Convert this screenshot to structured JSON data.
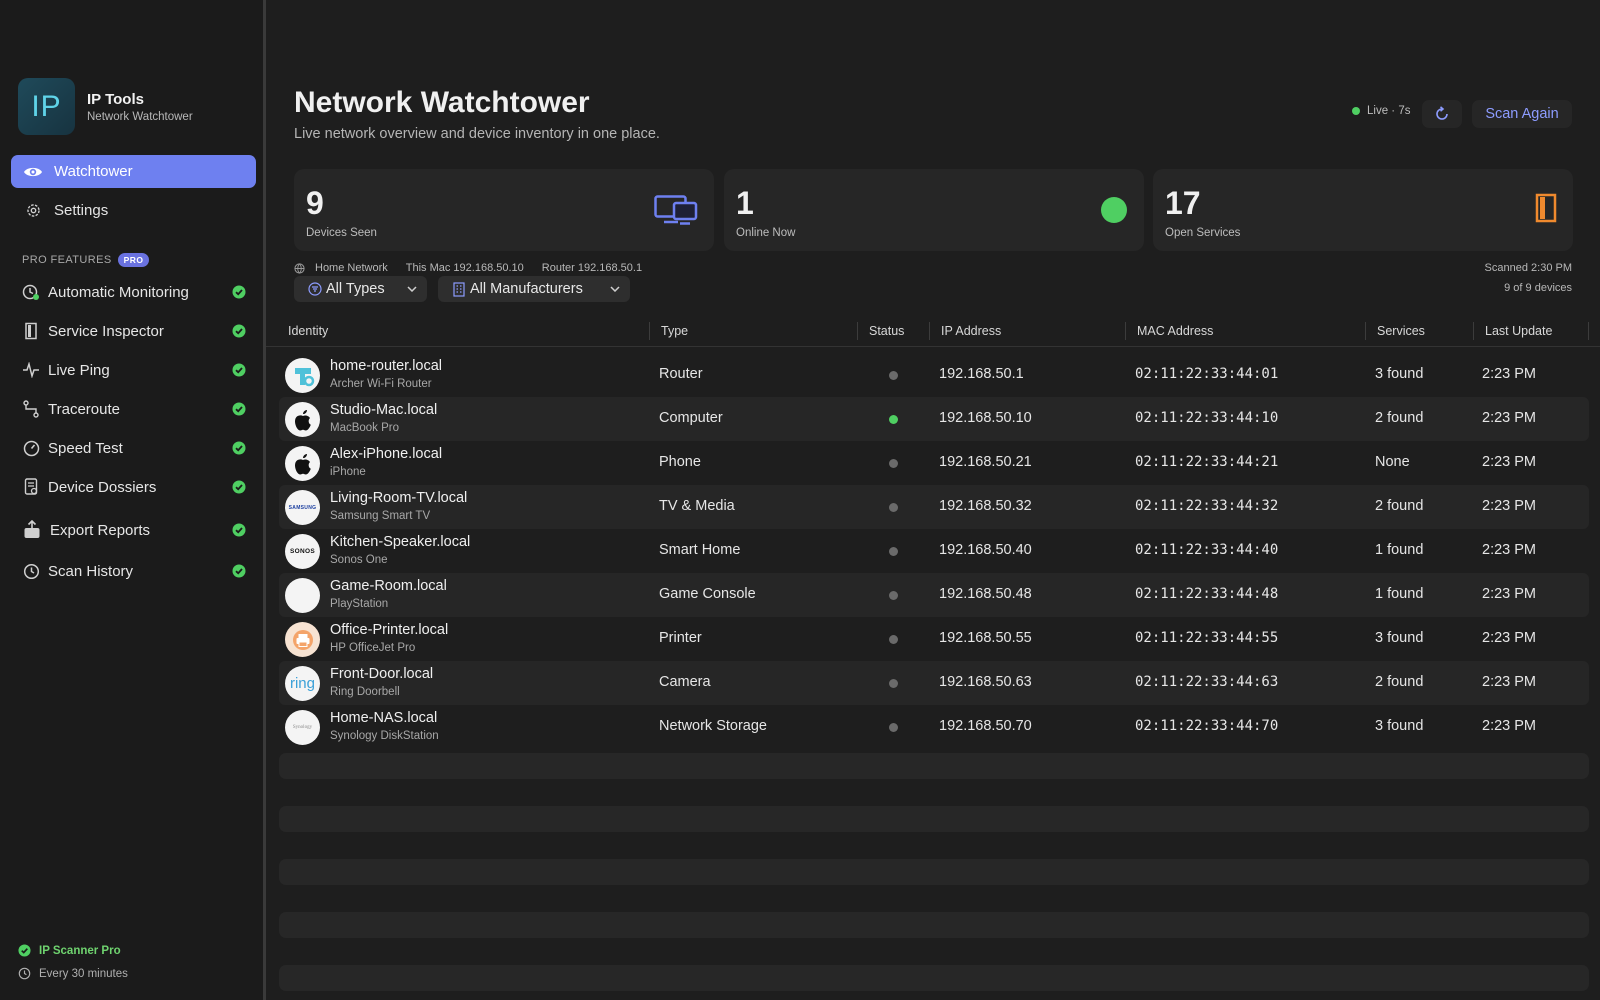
{
  "app": {
    "logo_text": "IP",
    "title": "IP Tools",
    "subtitle": "Network Watchtower"
  },
  "nav": [
    {
      "label": "Watchtower",
      "icon": "eye-icon",
      "active": true
    },
    {
      "label": "Settings",
      "icon": "gear-icon",
      "active": false
    }
  ],
  "pro": {
    "heading": "PRO FEATURES",
    "badge": "PRO",
    "items": [
      {
        "label": "Automatic Monitoring",
        "icon": "monitoring-icon"
      },
      {
        "label": "Service Inspector",
        "icon": "door-icon"
      },
      {
        "label": "Live Ping",
        "icon": "pulse-icon"
      },
      {
        "label": "Traceroute",
        "icon": "route-icon"
      },
      {
        "label": "Speed Test",
        "icon": "gauge-icon"
      },
      {
        "label": "Device Dossiers",
        "icon": "document-icon"
      },
      {
        "label": "Export Reports",
        "icon": "export-icon"
      },
      {
        "label": "Scan History",
        "icon": "history-icon"
      }
    ]
  },
  "footer": {
    "plan": "IP Scanner Pro",
    "interval": "Every 30 minutes"
  },
  "header": {
    "title": "Network Watchtower",
    "subtitle": "Live network overview and device inventory in one place.",
    "live_label": "Live · 7s",
    "scan_label": "Scan Again"
  },
  "cards": [
    {
      "value": "9",
      "label": "Devices Seen",
      "icon": "devices-icon"
    },
    {
      "value": "1",
      "label": "Online Now",
      "icon": "online-dot-icon"
    },
    {
      "value": "17",
      "label": "Open Services",
      "icon": "door-icon"
    }
  ],
  "network": {
    "name": "Home Network",
    "this_mac": "This Mac 192.168.50.10",
    "router": "Router 192.168.50.1",
    "scanned": "Scanned 2:30 PM",
    "count": "9 of 9 devices"
  },
  "filters": {
    "types": "All Types",
    "manufacturers": "All Manufacturers"
  },
  "columns": [
    "Identity",
    "Type",
    "Status",
    "IP Address",
    "MAC Address",
    "Services",
    "Last Update"
  ],
  "devices": [
    {
      "name": "home-router.local",
      "model": "Archer Wi-Fi Router",
      "type": "Router",
      "online": false,
      "ip": "192.168.50.1",
      "mac": "02:11:22:33:44:01",
      "services": "3 found",
      "updated": "2:23 PM",
      "avatar": "tplink-logo"
    },
    {
      "name": "Studio-Mac.local",
      "model": "MacBook Pro",
      "type": "Computer",
      "online": true,
      "ip": "192.168.50.10",
      "mac": "02:11:22:33:44:10",
      "services": "2 found",
      "updated": "2:23 PM",
      "avatar": "apple-logo"
    },
    {
      "name": "Alex-iPhone.local",
      "model": "iPhone",
      "type": "Phone",
      "online": false,
      "ip": "192.168.50.21",
      "mac": "02:11:22:33:44:21",
      "services": "None",
      "updated": "2:23 PM",
      "avatar": "apple-logo"
    },
    {
      "name": "Living-Room-TV.local",
      "model": "Samsung Smart TV",
      "type": "TV & Media",
      "online": false,
      "ip": "192.168.50.32",
      "mac": "02:11:22:33:44:32",
      "services": "2 found",
      "updated": "2:23 PM",
      "avatar": "samsung-logo",
      "logo_text": "SAMSUNG"
    },
    {
      "name": "Kitchen-Speaker.local",
      "model": "Sonos One",
      "type": "Smart Home",
      "online": false,
      "ip": "192.168.50.40",
      "mac": "02:11:22:33:44:40",
      "services": "1 found",
      "updated": "2:23 PM",
      "avatar": "sonos-logo",
      "logo_text": "SONOS"
    },
    {
      "name": "Game-Room.local",
      "model": "PlayStation",
      "type": "Game Console",
      "online": false,
      "ip": "192.168.50.48",
      "mac": "02:11:22:33:44:48",
      "services": "1 found",
      "updated": "2:23 PM",
      "avatar": "blank-logo"
    },
    {
      "name": "Office-Printer.local",
      "model": "HP OfficeJet Pro",
      "type": "Printer",
      "online": false,
      "ip": "192.168.50.55",
      "mac": "02:11:22:33:44:55",
      "services": "3 found",
      "updated": "2:23 PM",
      "avatar": "printer-icon"
    },
    {
      "name": "Front-Door.local",
      "model": "Ring Doorbell",
      "type": "Camera",
      "online": false,
      "ip": "192.168.50.63",
      "mac": "02:11:22:33:44:63",
      "services": "2 found",
      "updated": "2:23 PM",
      "avatar": "ring-logo",
      "logo_text": "ring"
    },
    {
      "name": "Home-NAS.local",
      "model": "Synology DiskStation",
      "type": "Network Storage",
      "online": false,
      "ip": "192.168.50.70",
      "mac": "02:11:22:33:44:70",
      "services": "3 found",
      "updated": "2:23 PM",
      "avatar": "synology-logo",
      "logo_text": "Synology"
    }
  ],
  "colors": {
    "accent": "#6e80f0",
    "online": "#4fcf62",
    "offline": "#6a6a6a",
    "scan_link": "#8d9cff",
    "check": "#4fcf62",
    "door": "#f08a2e"
  }
}
